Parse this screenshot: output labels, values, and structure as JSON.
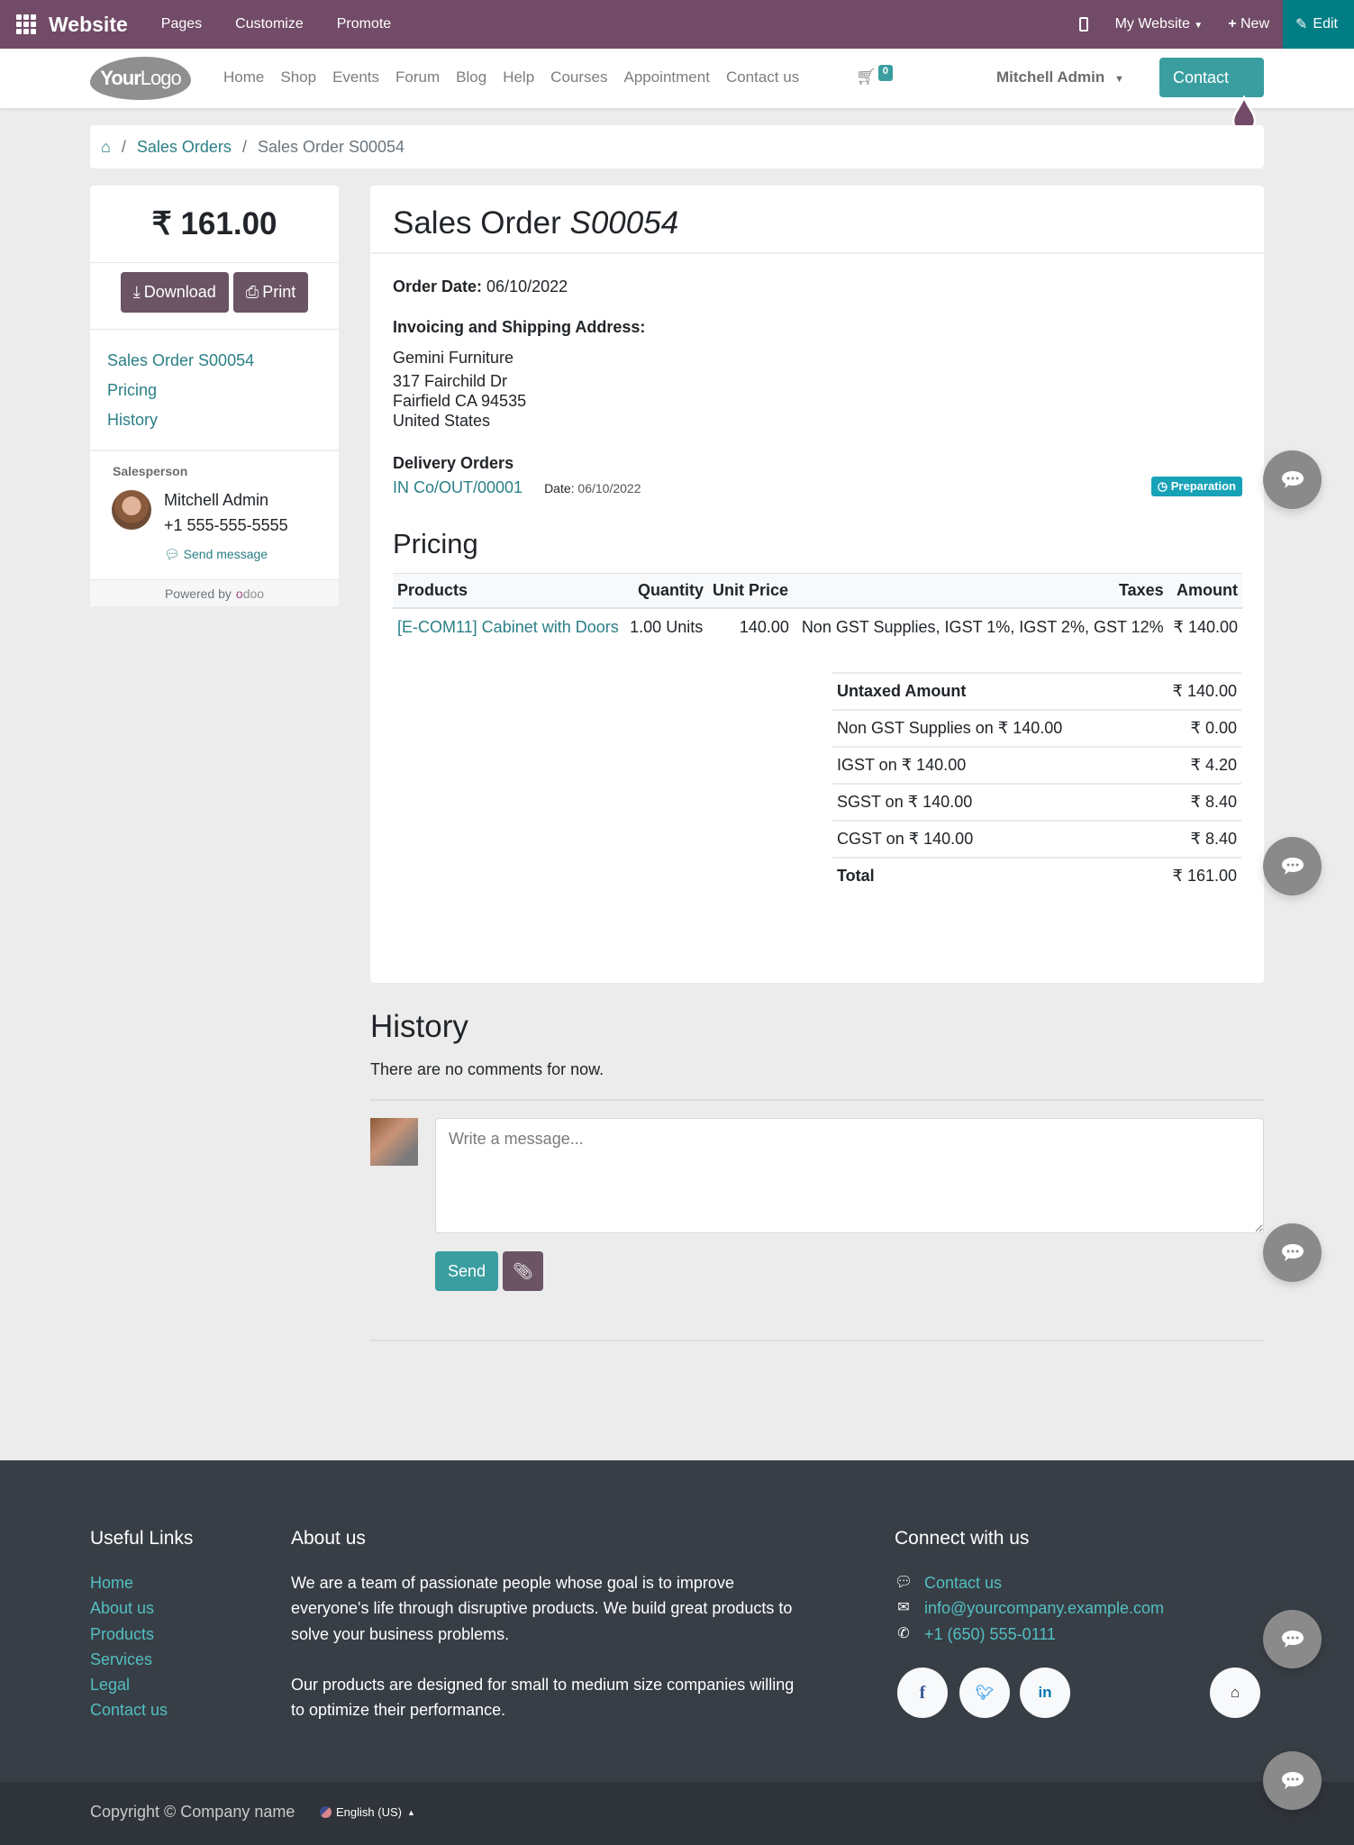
{
  "topbar": {
    "brand": "Website",
    "menus": [
      "Pages",
      "Customize",
      "Promote"
    ],
    "website_selector": "My Website",
    "new_label": "New",
    "edit_label": "Edit"
  },
  "header": {
    "logo_bold": "Your",
    "logo_light": "Logo",
    "nav": [
      "Home",
      "Shop",
      "Events",
      "Forum",
      "Blog",
      "Help",
      "Courses",
      "Appointment",
      "Contact us"
    ],
    "cart_count": "0",
    "user": "Mitchell Admin",
    "contact_button": "Contact"
  },
  "breadcrumb": {
    "items": [
      "Sales Orders",
      "Sales Order S00054"
    ]
  },
  "sidebar": {
    "amount": "₹ 161.00",
    "download_label": "Download",
    "print_label": "Print",
    "links": [
      "Sales Order S00054",
      "Pricing",
      "History"
    ],
    "salesperson_label": "Salesperson",
    "salesperson_name": "Mitchell Admin",
    "salesperson_phone": "+1 555-555-5555",
    "send_message": "Send message",
    "powered_by": "Powered by",
    "odoo_brand_o": "o",
    "odoo_brand_rest": "doo"
  },
  "order": {
    "title_prefix": "Sales Order",
    "number": "S00054",
    "order_date_label": "Order Date:",
    "order_date": "06/10/2022",
    "address_label": "Invoicing and Shipping Address:",
    "address_lines": [
      "Gemini Furniture",
      "317 Fairchild Dr",
      "Fairfield CA 94535",
      "United States"
    ],
    "delivery_label": "Delivery Orders",
    "delivery_ref": "IN Co/OUT/00001",
    "delivery_date_label": "Date:",
    "delivery_date": "06/10/2022",
    "delivery_status": "Preparation",
    "pricing_title": "Pricing",
    "columns": [
      "Products",
      "Quantity",
      "Unit Price",
      "Taxes",
      "Amount"
    ],
    "lines": [
      {
        "product": "[E-COM11] Cabinet with Doors",
        "quantity": "1.00 Units",
        "unit_price": "140.00",
        "taxes": "Non GST Supplies, IGST 1%, IGST 2%, GST 12%",
        "amount": "₹ 140.00"
      }
    ],
    "totals": [
      {
        "label": "Untaxed Amount",
        "value": "₹ 140.00",
        "bold": true
      },
      {
        "label": "Non GST Supplies on ₹ 140.00",
        "value": "₹ 0.00",
        "bold": false
      },
      {
        "label": "IGST on ₹ 140.00",
        "value": "₹ 4.20",
        "bold": false
      },
      {
        "label": "SGST on ₹ 140.00",
        "value": "₹ 8.40",
        "bold": false
      },
      {
        "label": "CGST on ₹ 140.00",
        "value": "₹ 8.40",
        "bold": false
      },
      {
        "label": "Total",
        "value": "₹ 161.00",
        "bold": true
      }
    ]
  },
  "history": {
    "title": "History",
    "empty_text": "There are no comments for now.",
    "message_placeholder": "Write a message...",
    "send_label": "Send"
  },
  "footer": {
    "useful_links_title": "Useful Links",
    "useful_links": [
      "Home",
      "About us",
      "Products",
      "Services",
      "Legal",
      "Contact us"
    ],
    "about_title": "About us",
    "about_p1": "We are a team of passionate people whose goal is to improve everyone's life through disruptive products. We build great products to solve your business problems.",
    "about_p2": "Our products are designed for small to medium size companies willing to optimize their performance.",
    "connect_title": "Connect with us",
    "contact_link": "Contact us",
    "email": "info@yourcompany.example.com",
    "phone": "+1 (650) 555-0111",
    "copyright": "Copyright © Company name",
    "language": "English (US)"
  },
  "colors": {
    "admin_bar": "#714b67",
    "edit_button": "#017e84",
    "primary": "#3a9ea0",
    "secondary": "#6b5464",
    "link": "#2a7f86",
    "status_badge": "#17a2b8",
    "footer_bg": "#383e45"
  }
}
